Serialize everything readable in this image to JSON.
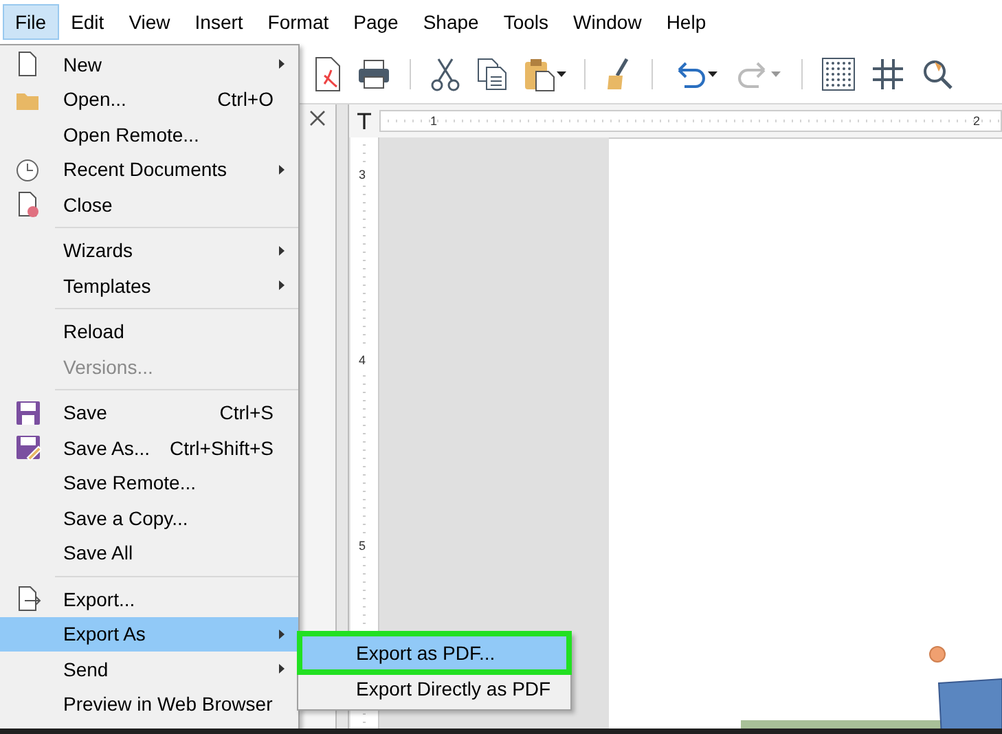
{
  "menubar": [
    {
      "label": "File",
      "selected": true
    },
    {
      "label": "Edit",
      "selected": false
    },
    {
      "label": "View",
      "selected": false
    },
    {
      "label": "Insert",
      "selected": false
    },
    {
      "label": "Format",
      "selected": false
    },
    {
      "label": "Page",
      "selected": false
    },
    {
      "label": "Shape",
      "selected": false
    },
    {
      "label": "Tools",
      "selected": false
    },
    {
      "label": "Window",
      "selected": false
    },
    {
      "label": "Help",
      "selected": false
    }
  ],
  "ruler": {
    "horizontal": [
      "1",
      "2"
    ],
    "vertical": [
      "3",
      "4",
      "5"
    ]
  },
  "file_menu": {
    "groups": [
      [
        {
          "label": "New",
          "submenu": true,
          "disabled": false,
          "selected": false
        },
        {
          "label": "Open...",
          "shortcut": "Ctrl+O",
          "submenu": false,
          "disabled": false,
          "selected": false
        },
        {
          "label": "Open Remote...",
          "submenu": false,
          "disabled": false,
          "selected": false
        },
        {
          "label": "Recent Documents",
          "submenu": true,
          "disabled": false,
          "selected": false
        },
        {
          "label": "Close",
          "submenu": false,
          "disabled": false,
          "selected": false
        }
      ],
      [
        {
          "label": "Wizards",
          "submenu": true,
          "disabled": false,
          "selected": false
        },
        {
          "label": "Templates",
          "submenu": true,
          "disabled": false,
          "selected": false
        }
      ],
      [
        {
          "label": "Reload",
          "submenu": false,
          "disabled": false,
          "selected": false
        },
        {
          "label": "Versions...",
          "submenu": false,
          "disabled": true,
          "selected": false
        }
      ],
      [
        {
          "label": "Save",
          "shortcut": "Ctrl+S",
          "submenu": false,
          "disabled": false,
          "selected": false
        },
        {
          "label": "Save As...",
          "shortcut": "Ctrl+Shift+S",
          "submenu": false,
          "disabled": false,
          "selected": false
        },
        {
          "label": "Save Remote...",
          "submenu": false,
          "disabled": false,
          "selected": false
        },
        {
          "label": "Save a Copy...",
          "submenu": false,
          "disabled": false,
          "selected": false
        },
        {
          "label": "Save All",
          "submenu": false,
          "disabled": false,
          "selected": false
        }
      ],
      [
        {
          "label": "Export...",
          "submenu": false,
          "disabled": false,
          "selected": false
        },
        {
          "label": "Export As",
          "submenu": true,
          "disabled": false,
          "selected": true
        },
        {
          "label": "Send",
          "submenu": true,
          "disabled": false,
          "selected": false
        },
        {
          "label": "Preview in Web Browser",
          "submenu": false,
          "disabled": false,
          "selected": false
        }
      ]
    ]
  },
  "export_submenu": {
    "items": [
      {
        "label": "Export as PDF...",
        "selected": true,
        "highlighted": true
      },
      {
        "label": "Export Directly as PDF",
        "selected": false,
        "highlighted": false
      }
    ]
  }
}
